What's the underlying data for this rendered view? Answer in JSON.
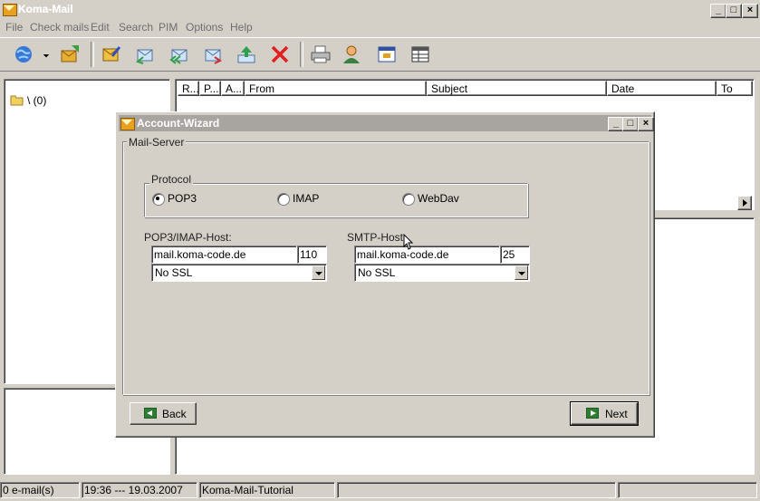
{
  "window": {
    "title": "Koma-Mail",
    "minimize": "_",
    "maximize": "□",
    "close": "×"
  },
  "menu": [
    "File",
    "Check mails",
    "Edit",
    "Search",
    "PIM",
    "Options",
    "Help"
  ],
  "toolbar": [
    "globe-icon",
    "get-mail-icon",
    "new-mail-icon",
    "reply-icon",
    "reply-all-icon",
    "forward-icon",
    "upload-icon",
    "delete-icon",
    "print-icon",
    "contacts-icon",
    "window-icon",
    "table-icon"
  ],
  "folders": {
    "root": "\\ (0)"
  },
  "columns": [
    "R...",
    "P...",
    "A...",
    "From",
    "Subject",
    "Date",
    "To"
  ],
  "status": {
    "count": "0 e-mail(s)",
    "datetime": "19:36 --- 19.03.2007",
    "account": "Koma-Mail-Tutorial"
  },
  "dialog": {
    "title": "Account-Wizard",
    "group": "Mail-Server",
    "protocol": {
      "label": "Protocol",
      "options": [
        "POP3",
        "IMAP",
        "WebDav"
      ],
      "selected": "POP3"
    },
    "incoming": {
      "label": "POP3/IMAP-Host:",
      "host": "mail.koma-code.de",
      "port": "110",
      "ssl": "No SSL"
    },
    "outgoing": {
      "label": "SMTP-Host:",
      "host": "mail.koma-code.de",
      "port": "25",
      "ssl": "No SSL"
    },
    "back": "Back",
    "next": "Next"
  }
}
